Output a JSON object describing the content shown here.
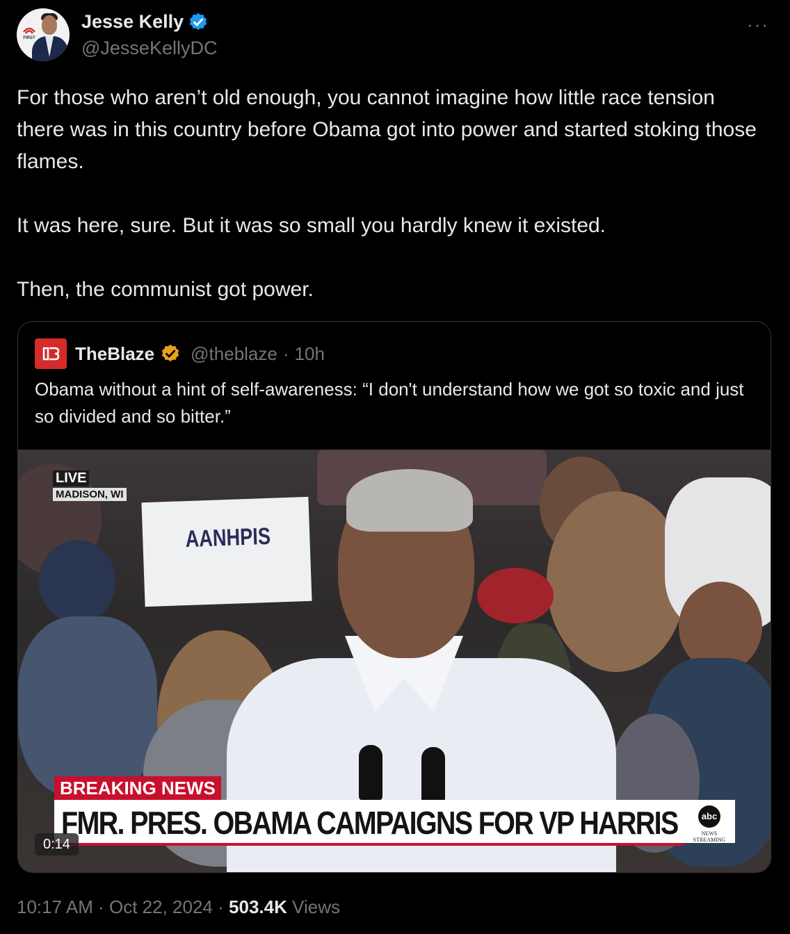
{
  "author": {
    "display_name": "Jesse Kelly",
    "handle": "@JesseKellyDC",
    "verified": true,
    "verified_color": "#1d9bf0",
    "avatar_logo_text": "FIRST"
  },
  "more_label": "···",
  "tweet": {
    "paragraphs": [
      "For those who aren’t old enough, you cannot imagine how little race tension there was in this country before Obama got into power and started stoking those flames.",
      "It was here, sure. But it was so small you hardly knew it existed.",
      "Then, the communist got power."
    ]
  },
  "quote": {
    "display_name": "TheBlaze",
    "handle": "@theblaze",
    "separator": "·",
    "time": "10h",
    "verified_color": "#e8a317",
    "text": "Obama without a hint of self-awareness: “I don't understand how we got so toxic and just so divided and so bitter.”",
    "video": {
      "live_label": "LIVE",
      "location": "MADISON, WI",
      "sign_text": "AANHPIS",
      "breaking_label": "BREAKING NEWS",
      "headline": "FMR. PRES. OBAMA CAMPAIGNS FOR VP HARRIS",
      "network_logo": "abc",
      "network_sub": "NEWS STREAMING",
      "duration": "0:14"
    }
  },
  "meta": {
    "time": "10:17 AM",
    "sep1": "·",
    "date": "Oct 22, 2024",
    "sep2": "·",
    "views_count": "503.4K",
    "views_label": "Views"
  }
}
